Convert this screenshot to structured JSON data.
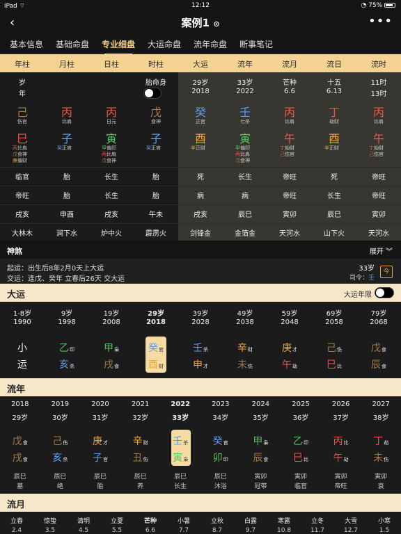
{
  "status": {
    "device": "iPad",
    "time": "12:12",
    "battery": "75%"
  },
  "nav": {
    "title": "案例1",
    "title_icon": "chevron-down-circle-icon",
    "back_icon": "back-chevron-icon",
    "more_icon": "more-dots-icon"
  },
  "tabs": [
    "基本信息",
    "基础命盘",
    "专业细盘",
    "大运命盘",
    "流年命盘",
    "断事笔记"
  ],
  "active_tab": 2,
  "columns": [
    "年柱",
    "月柱",
    "日柱",
    "时柱",
    "大运",
    "流年",
    "流月",
    "流日",
    "流时"
  ],
  "top_rows": {
    "row1": [
      "岁",
      "",
      "",
      "胎命身",
      "29岁",
      "33岁",
      "芒种",
      "十五",
      "11时"
    ],
    "row2": [
      "年",
      "",
      "",
      "",
      "2018",
      "2022",
      "6.6",
      "6.13",
      "13时"
    ]
  },
  "stems": [
    {
      "char": "己",
      "god": "伤官",
      "color": "#a07a4a"
    },
    {
      "char": "丙",
      "god": "比肩",
      "color": "#f0534b"
    },
    {
      "char": "丙",
      "god": "日元",
      "color": "#f0534b"
    },
    {
      "char": "戊",
      "god": "食神",
      "color": "#a07a4a"
    },
    {
      "char": "癸",
      "god": "正官",
      "color": "#5b9cf2"
    },
    {
      "char": "壬",
      "god": "七杀",
      "color": "#5b9cf2"
    },
    {
      "char": "丙",
      "god": "比肩",
      "color": "#f0534b"
    },
    {
      "char": "丁",
      "god": "劫财",
      "color": "#f0534b"
    },
    {
      "char": "丙",
      "god": "比肩",
      "color": "#f0534b"
    }
  ],
  "branches": [
    {
      "char": "巳",
      "color": "#f0534b",
      "hidden": [
        [
          "丙",
          "比肩",
          "#f0534b"
        ],
        [
          "戊",
          "食神",
          "#a07a4a"
        ],
        [
          "庚",
          "偏财",
          "#e8a53a"
        ]
      ]
    },
    {
      "char": "子",
      "color": "#5b9cf2",
      "hidden": [
        [
          "癸",
          "正官",
          "#5b9cf2"
        ]
      ]
    },
    {
      "char": "寅",
      "color": "#59c15c",
      "hidden": [
        [
          "甲",
          "偏印",
          "#59c15c"
        ],
        [
          "丙",
          "比肩",
          "#f0534b"
        ],
        [
          "戊",
          "食神",
          "#a07a4a"
        ]
      ]
    },
    {
      "char": "子",
      "color": "#5b9cf2",
      "hidden": [
        [
          "癸",
          "正官",
          "#5b9cf2"
        ]
      ]
    },
    {
      "char": "酉",
      "color": "#e8a53a",
      "hidden": [
        [
          "辛",
          "正财",
          "#e8a53a"
        ]
      ]
    },
    {
      "char": "寅",
      "color": "#59c15c",
      "hidden": [
        [
          "甲",
          "偏印",
          "#59c15c"
        ],
        [
          "丙",
          "比肩",
          "#f0534b"
        ],
        [
          "戊",
          "食神",
          "#a07a4a"
        ]
      ]
    },
    {
      "char": "午",
      "color": "#f0534b",
      "hidden": [
        [
          "丁",
          "劫财",
          "#f0534b"
        ],
        [
          "己",
          "伤官",
          "#a07a4a"
        ]
      ]
    },
    {
      "char": "酉",
      "color": "#e8a53a",
      "hidden": [
        [
          "辛",
          "正财",
          "#e8a53a"
        ]
      ]
    },
    {
      "char": "午",
      "color": "#f0534b",
      "hidden": [
        [
          "丁",
          "劫财",
          "#f0534b"
        ],
        [
          "己",
          "伤官",
          "#a07a4a"
        ]
      ]
    }
  ],
  "lower_rows": [
    [
      "临官",
      "胎",
      "长生",
      "胎",
      "死",
      "长生",
      "帝旺",
      "死",
      "帝旺"
    ],
    [
      "帝旺",
      "胎",
      "长生",
      "胎",
      "病",
      "病",
      "帝旺",
      "长生",
      "帝旺"
    ],
    [
      "戌亥",
      "申酉",
      "戌亥",
      "午未",
      "戌亥",
      "辰巳",
      "寅卯",
      "辰巳",
      "寅卯"
    ],
    [
      "大林木",
      "涧下水",
      "炉中火",
      "霹雳火",
      "剑锋金",
      "金箔金",
      "天河水",
      "山下火",
      "天河水"
    ]
  ],
  "shensha": {
    "label": "神煞",
    "expand": "展开"
  },
  "qiyun": {
    "line1": "起运：出生后8年2月0天上大运",
    "line2": "交运：逢戊、癸年 立春后26天 交大运",
    "age": "33岁",
    "siling_label": "司令：",
    "siling_value": "壬",
    "calendar_icon": "calendar-icon",
    "cal_char": "今"
  },
  "dayun": {
    "title": "大运",
    "toggle_label": "大运年限",
    "ages": [
      "1-8岁",
      "9岁",
      "19岁",
      "29岁",
      "39岁",
      "49岁",
      "59岁",
      "69岁",
      "79岁"
    ],
    "years": [
      "1990",
      "1998",
      "2008",
      "2018",
      "2028",
      "2038",
      "2048",
      "2058",
      "2068"
    ],
    "first": [
      "小",
      "运"
    ],
    "stems": [
      [
        "乙",
        "印",
        "#59c15c"
      ],
      [
        "甲",
        "枭",
        "#59c15c"
      ],
      [
        "癸",
        "官",
        "#5b9cf2"
      ],
      [
        "壬",
        "杀",
        "#5b9cf2"
      ],
      [
        "辛",
        "财",
        "#e8a53a"
      ],
      [
        "庚",
        "才",
        "#e8a53a"
      ],
      [
        "己",
        "伤",
        "#a07a4a"
      ],
      [
        "戊",
        "食",
        "#a07a4a"
      ]
    ],
    "branches": [
      [
        "亥",
        "杀",
        "#5b9cf2"
      ],
      [
        "戌",
        "食",
        "#a07a4a"
      ],
      [
        "酉",
        "财",
        "#e8a53a"
      ],
      [
        "申",
        "才",
        "#e8a53a"
      ],
      [
        "未",
        "伤",
        "#a07a4a"
      ],
      [
        "午",
        "劫",
        "#f0534b"
      ],
      [
        "巳",
        "比",
        "#f0534b"
      ],
      [
        "辰",
        "食",
        "#a07a4a"
      ]
    ],
    "selected": 3
  },
  "liunian": {
    "title": "流年",
    "years": [
      "2018",
      "2019",
      "2020",
      "2021",
      "2022",
      "2023",
      "2024",
      "2025",
      "2026",
      "2027"
    ],
    "ages": [
      "29岁",
      "30岁",
      "31岁",
      "32岁",
      "33岁",
      "34岁",
      "35岁",
      "36岁",
      "37岁",
      "38岁"
    ],
    "stems": [
      [
        "戊",
        "食",
        "#a07a4a"
      ],
      [
        "己",
        "伤",
        "#a07a4a"
      ],
      [
        "庚",
        "才",
        "#e8a53a"
      ],
      [
        "辛",
        "财",
        "#e8a53a"
      ],
      [
        "壬",
        "杀",
        "#5b9cf2"
      ],
      [
        "癸",
        "官",
        "#5b9cf2"
      ],
      [
        "甲",
        "枭",
        "#59c15c"
      ],
      [
        "乙",
        "印",
        "#59c15c"
      ],
      [
        "丙",
        "比",
        "#f0534b"
      ],
      [
        "丁",
        "劫",
        "#f0534b"
      ]
    ],
    "branches": [
      [
        "戌",
        "食",
        "#a07a4a"
      ],
      [
        "亥",
        "杀",
        "#5b9cf2"
      ],
      [
        "子",
        "官",
        "#5b9cf2"
      ],
      [
        "丑",
        "伤",
        "#a07a4a"
      ],
      [
        "寅",
        "枭",
        "#59c15c"
      ],
      [
        "卯",
        "印",
        "#59c15c"
      ],
      [
        "辰",
        "食",
        "#a07a4a"
      ],
      [
        "巳",
        "比",
        "#f0534b"
      ],
      [
        "午",
        "劫",
        "#f0534b"
      ],
      [
        "未",
        "伤",
        "#a07a4a"
      ]
    ],
    "kong": [
      "辰巳",
      "辰巳",
      "辰巳",
      "辰巳",
      "辰巳",
      "辰巳",
      "寅卯",
      "寅卯",
      "寅卯",
      "寅卯"
    ],
    "state": [
      "墓",
      "绝",
      "胎",
      "养",
      "长生",
      "沐浴",
      "冠带",
      "临官",
      "帝旺",
      "衰"
    ],
    "selected": 4
  },
  "liuyue": {
    "title": "流月",
    "terms": [
      "立春",
      "惊蛰",
      "清明",
      "立夏",
      "芒种",
      "小暑",
      "立秋",
      "白露",
      "寒露",
      "立冬",
      "大雪",
      "小寒"
    ],
    "dates": [
      "2.4",
      "3.5",
      "4.5",
      "5.5",
      "6.6",
      "7.7",
      "8.7",
      "9.7",
      "10.8",
      "11.7",
      "12.7",
      "1.5"
    ]
  }
}
